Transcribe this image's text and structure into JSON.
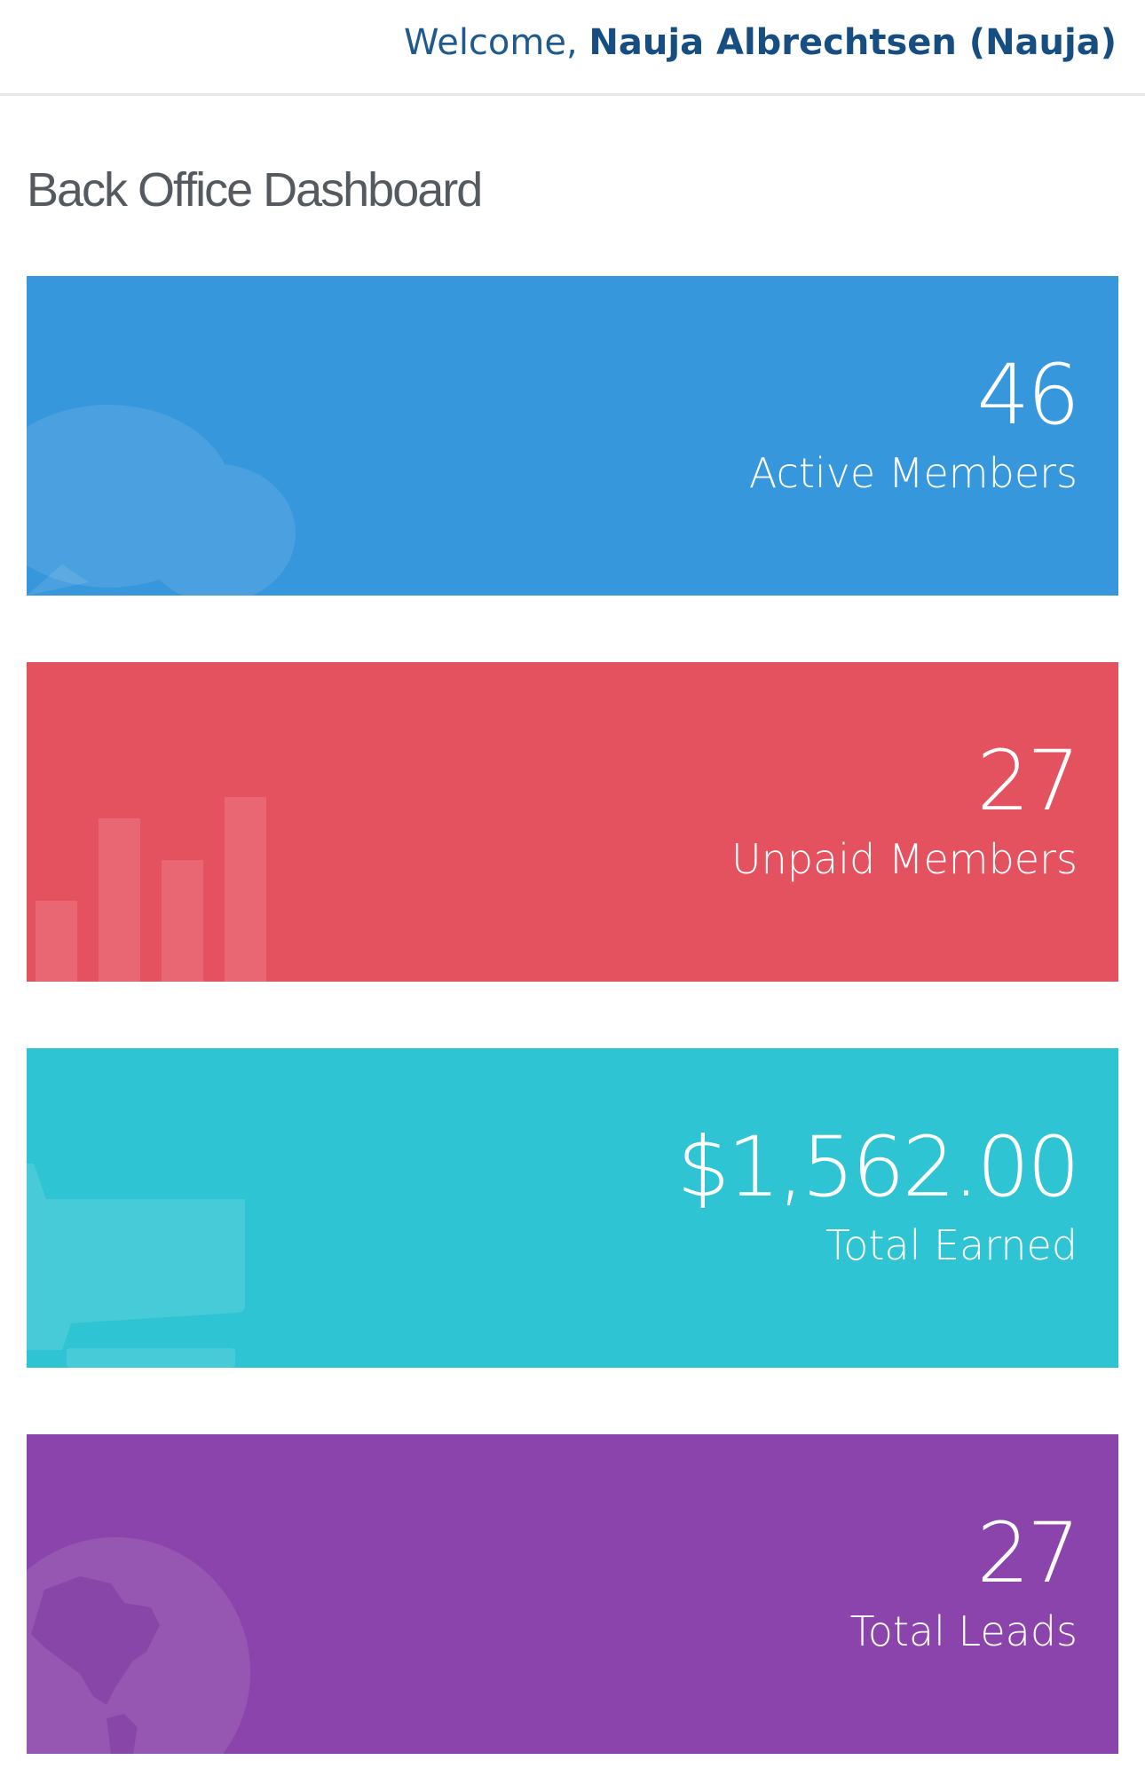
{
  "header": {
    "welcome_prefix": "Welcome, ",
    "user_name": "Nauja Albrechtsen (Nauja)"
  },
  "page": {
    "title": "Back Office Dashboard"
  },
  "stats": {
    "active_members": {
      "value": "46",
      "label": "Active Members",
      "color": "#3797dc",
      "icon": "chat-bubbles-icon"
    },
    "unpaid_members": {
      "value": "27",
      "label": "Unpaid Members",
      "color": "#e5525f",
      "icon": "bar-chart-icon"
    },
    "total_earned": {
      "value": "$1,562.00",
      "label": "Total Earned",
      "color": "#2fc4d3",
      "icon": "shopping-cart-icon"
    },
    "total_leads": {
      "value": "27",
      "label": "Total Leads",
      "color": "#8b44ab",
      "icon": "globe-icon"
    }
  }
}
